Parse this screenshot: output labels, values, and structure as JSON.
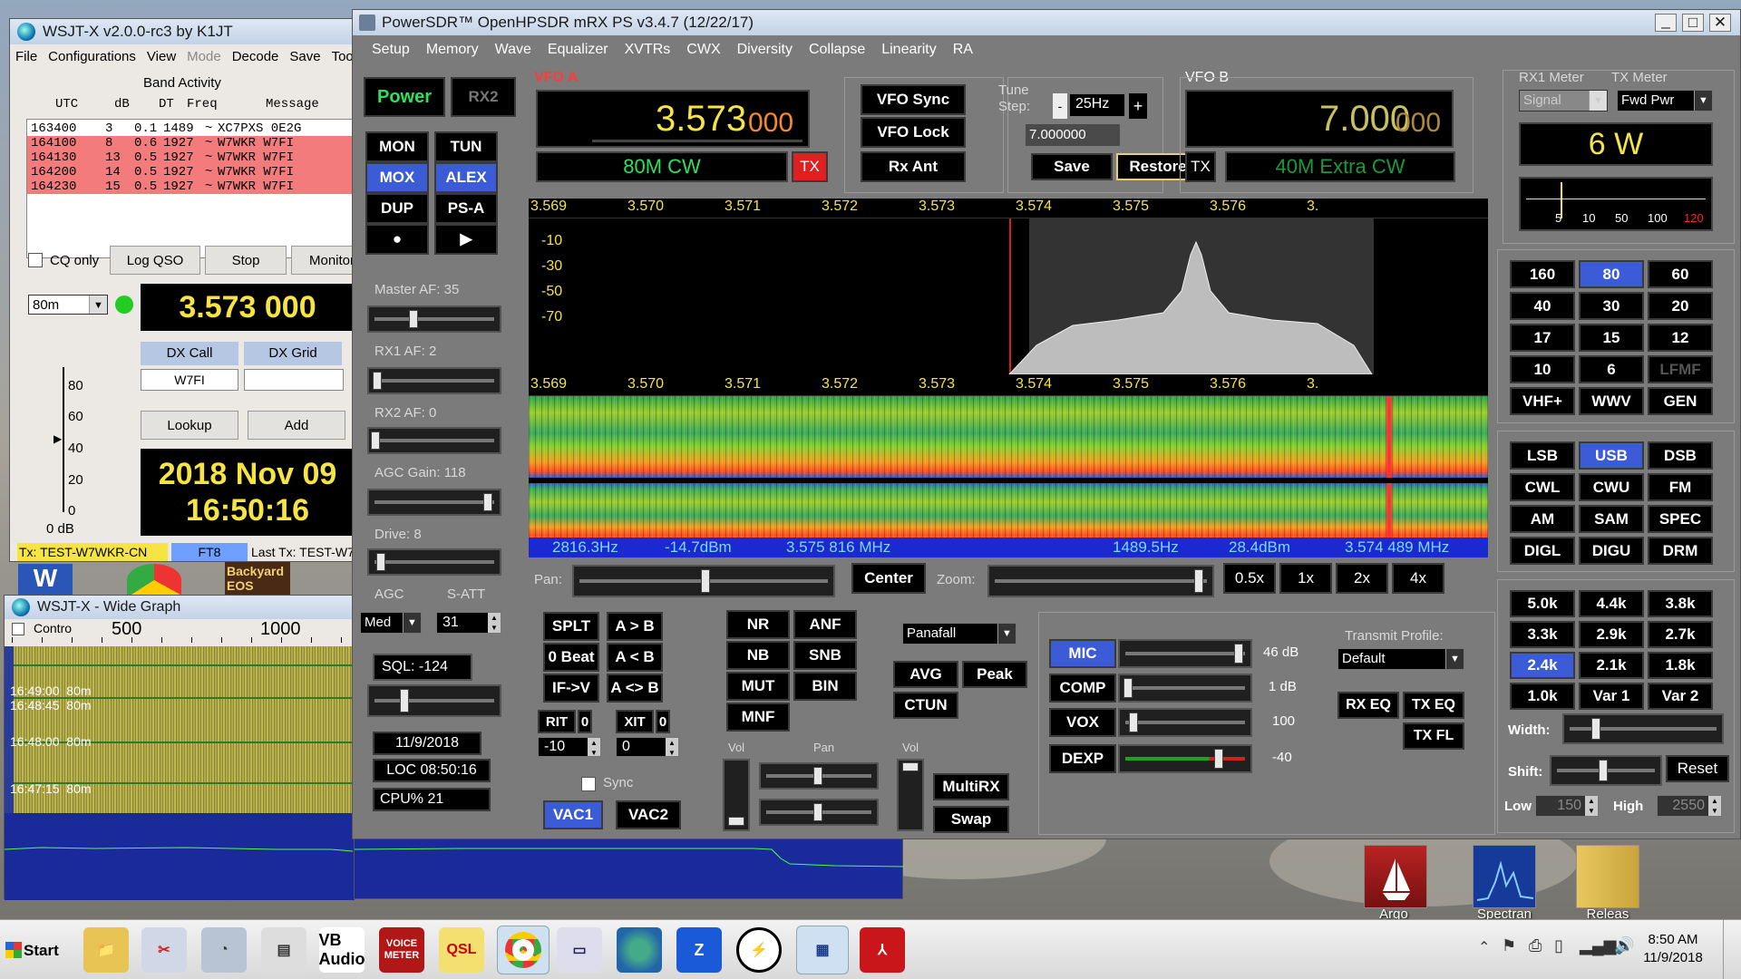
{
  "wsjt": {
    "title": "WSJT-X   v2.0.0-rc3   by K1JT",
    "menu": [
      "File",
      "Configurations",
      "View",
      "Mode",
      "Decode",
      "Save",
      "Tools"
    ],
    "band_activity_label": "Band Activity",
    "col_headers": [
      "UTC",
      "dB",
      "DT",
      "Freq",
      "Message"
    ],
    "rows": [
      {
        "utc": "163400",
        "db": "3",
        "dt": "0.1",
        "freq": "1489",
        "sep": "~",
        "msg": "XC7PXS 0E2G"
      },
      {
        "utc": "164100",
        "db": "8",
        "dt": "0.6",
        "freq": "1927",
        "sep": "~",
        "msg": "W7WKR W7FI"
      },
      {
        "utc": "164130",
        "db": "13",
        "dt": "0.5",
        "freq": "1927",
        "sep": "~",
        "msg": "W7WKR W7FI"
      },
      {
        "utc": "164200",
        "db": "14",
        "dt": "0.5",
        "freq": "1927",
        "sep": "~",
        "msg": "W7WKR W7FI"
      },
      {
        "utc": "164230",
        "db": "15",
        "dt": "0.5",
        "freq": "1927",
        "sep": "~",
        "msg": "W7WKR W7FI"
      }
    ],
    "cq_only": "CQ only",
    "log_qso": "Log QSO",
    "stop": "Stop",
    "monitor": "Monitor",
    "band": "80m",
    "freq_display": "3.573 000",
    "dx_call_label": "DX Call",
    "dx_grid_label": "DX Grid",
    "dx_call": "W7FI",
    "dx_grid": "",
    "scale_labels": [
      "80",
      "60",
      "40",
      "20",
      "0"
    ],
    "db_label": "0 dB",
    "lookup": "Lookup",
    "add": "Add",
    "date": "2018 Nov 09",
    "time": "16:50:16",
    "status_tx": "Tx: TEST-W7WKR-CN",
    "status_mode": "FT8",
    "status_last": "Last Tx: TEST-W7"
  },
  "desk_strip": {
    "backyard": "Backyard",
    "eos": "EOS"
  },
  "widegraph": {
    "title": "WSJT-X - Wide Graph",
    "controls": "Contro",
    "scale": [
      "500",
      "1000"
    ],
    "marks": [
      {
        "t": "16:49:00",
        "b": "80m"
      },
      {
        "t": "16:48:45",
        "b": "80m"
      },
      {
        "t": "16:48:00",
        "b": "80m"
      },
      {
        "t": "16:47:15",
        "b": "80m"
      }
    ]
  },
  "psdr": {
    "title": "PowerSDR™ OpenHPSDR mRX PS v3.4.7 (12/22/17)",
    "menu": [
      "Setup",
      "Memory",
      "Wave",
      "Equalizer",
      "XVTRs",
      "CWX",
      "Diversity",
      "Collapse",
      "Linearity",
      "RA"
    ],
    "power": "Power",
    "rx2": "RX2",
    "left_buttons": [
      "MON",
      "TUN",
      "MOX",
      "ALEX",
      "DUP",
      "PS-A",
      "●",
      "▶"
    ],
    "master_af": "Master AF:  35",
    "rx1_af": "RX1 AF:  2",
    "rx2_af": "RX2 AF:  0",
    "agc_gain": "AGC Gain:  118",
    "drive": "Drive:  8",
    "agc": "AGC",
    "satt": "S-ATT",
    "agc_mode": "Med",
    "satt_val": "31",
    "sql": "SQL:  -124",
    "date": "11/9/2018",
    "loc": "LOC 08:50:16",
    "cpu": "CPU%  21",
    "vfoa": {
      "label": "VFO A",
      "freq_main": "3.573",
      "freq_sub": "000",
      "band": "80M CW",
      "tx": "TX"
    },
    "vfob": {
      "label": "VFO B",
      "freq_main": "7.000",
      "freq_sub": "000",
      "band": "40M Extra CW",
      "tx": "TX"
    },
    "vfo_sync": "VFO Sync",
    "vfo_lock": "VFO Lock",
    "rx_ant": "Rx Ant",
    "tune_step_label": "Tune\nStep:",
    "tune_step": "25Hz",
    "tune_freq": "7.000000",
    "save": "Save",
    "restore": "Restore",
    "pan_freq_labels": [
      "3.569",
      "3.570",
      "3.571",
      "3.572",
      "3.573",
      "3.574",
      "3.575",
      "3.576",
      "3."
    ],
    "pan_db_labels": [
      "-10",
      "-30",
      "-50",
      "-70"
    ],
    "status": {
      "hz1": "2816.3Hz",
      "dbm1": "-14.7dBm",
      "mhz1": "3.575 816 MHz",
      "hz2": "1489.5Hz",
      "dbm2": "28.4dBm",
      "mhz2": "3.574 489 MHz"
    },
    "pan_label": "Pan:",
    "center": "Center",
    "zoom_label": "Zoom:",
    "zooms": [
      "0.5x",
      "1x",
      "2x",
      "4x"
    ],
    "split_buttons": [
      "SPLT",
      "A > B",
      "0 Beat",
      "A < B",
      "IF->V",
      "A <> B"
    ],
    "rit": "RIT",
    "rit_val": "0",
    "xit": "XIT",
    "xit_val": "0",
    "rit_spin": "-10",
    "xit_spin": "0",
    "sync": "Sync",
    "vac1": "VAC1",
    "vac2": "VAC2",
    "dsp_buttons": [
      "NR",
      "ANF",
      "NB",
      "SNB",
      "MUT",
      "BIN",
      "MNF"
    ],
    "vol": "Vol",
    "pan2": "Pan",
    "vol2": "Vol",
    "multirx": "MultiRX",
    "swap": "Swap",
    "display_mode": "Panafall",
    "avg": "AVG",
    "peak": "Peak",
    "ctun": "CTUN",
    "tx_rows": [
      {
        "b": "MIC",
        "v": "46 dB"
      },
      {
        "b": "COMP",
        "v": "1 dB"
      },
      {
        "b": "VOX",
        "v": "100"
      },
      {
        "b": "DEXP",
        "v": "-40"
      }
    ],
    "tx_profile_label": "Transmit Profile:",
    "tx_profile": "Default",
    "rx_eq": "RX EQ",
    "tx_eq": "TX EQ",
    "tx_fl": "TX FL",
    "rx1_meter": "RX1 Meter",
    "tx_meter": "TX Meter",
    "rx_meter_mode": "Signal",
    "tx_meter_mode": "Fwd Pwr",
    "power_reading": "6 W",
    "meter_scale": [
      "5",
      "10",
      "50",
      "100",
      "120"
    ],
    "bands": [
      "160",
      "80",
      "60",
      "40",
      "30",
      "20",
      "17",
      "15",
      "12",
      "10",
      "6",
      "LFMF",
      "VHF+",
      "WWV",
      "GEN"
    ],
    "modes": [
      "LSB",
      "USB",
      "DSB",
      "CWL",
      "CWU",
      "FM",
      "AM",
      "SAM",
      "SPEC",
      "DIGL",
      "DIGU",
      "DRM"
    ],
    "filters": [
      "5.0k",
      "4.4k",
      "3.8k",
      "3.3k",
      "2.9k",
      "2.7k",
      "2.4k",
      "2.1k",
      "1.8k",
      "1.0k",
      "Var 1",
      "Var 2"
    ],
    "width": "Width:",
    "shift": "Shift:",
    "reset": "Reset",
    "low": "Low",
    "low_val": "150",
    "high": "High",
    "high_val": "2550"
  },
  "desktop_icons": [
    "Argo",
    "Spectran",
    "Releas"
  ],
  "taskbar": {
    "start": "Start",
    "time": "8:50 AM",
    "date": "11/9/2018",
    "icons": [
      "folder",
      "tools",
      "gauge",
      "book",
      "VB Audio",
      "VOICE METER",
      "QSL",
      "chrome",
      "monitor",
      "globe",
      "Z-keys",
      "power",
      "spectrum",
      "pdf"
    ]
  },
  "colors": {
    "decode_highlight": "#f47b7b",
    "lcd_yellow": "#f5e442",
    "lcd_green": "#22cc44",
    "sel_blue": "#3b5bd7",
    "tx_red": "#e02020"
  }
}
